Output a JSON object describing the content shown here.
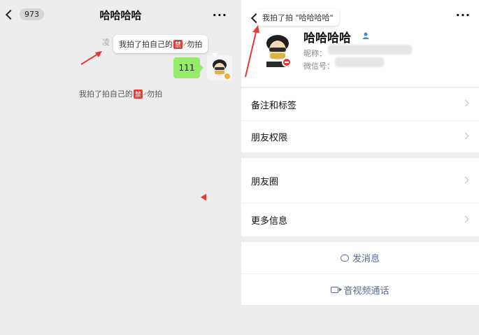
{
  "chat": {
    "back_count": "973",
    "title": "哈哈哈哈",
    "more": "···",
    "timestamp_partial": "凌",
    "tooltip": {
      "text_before": "我拍了拍自己的",
      "text_after": "勿拍",
      "ban_glyph": "禁"
    },
    "message": "111",
    "pat_line": {
      "text_before": "我拍了拍自己的",
      "text_after": "勿拍",
      "ban_glyph": "禁"
    }
  },
  "profile": {
    "more": "···",
    "tooltip": "我拍了拍 \"哈哈哈哈\"",
    "name": "哈哈哈哈",
    "nickname_label": "昵称：",
    "wechat_id_label": "微信号：",
    "rows": {
      "remark": "备注和标签",
      "permissions": "朋友权限",
      "moments": "朋友圈",
      "more_info": "更多信息"
    },
    "actions": {
      "send_message": "发消息",
      "video_call": "音视频通话"
    }
  },
  "colors": {
    "accent_link": "#576b95",
    "bubble_green": "#95ec69",
    "arrow_red": "#e53935",
    "ban_red": "#e23a3a"
  }
}
